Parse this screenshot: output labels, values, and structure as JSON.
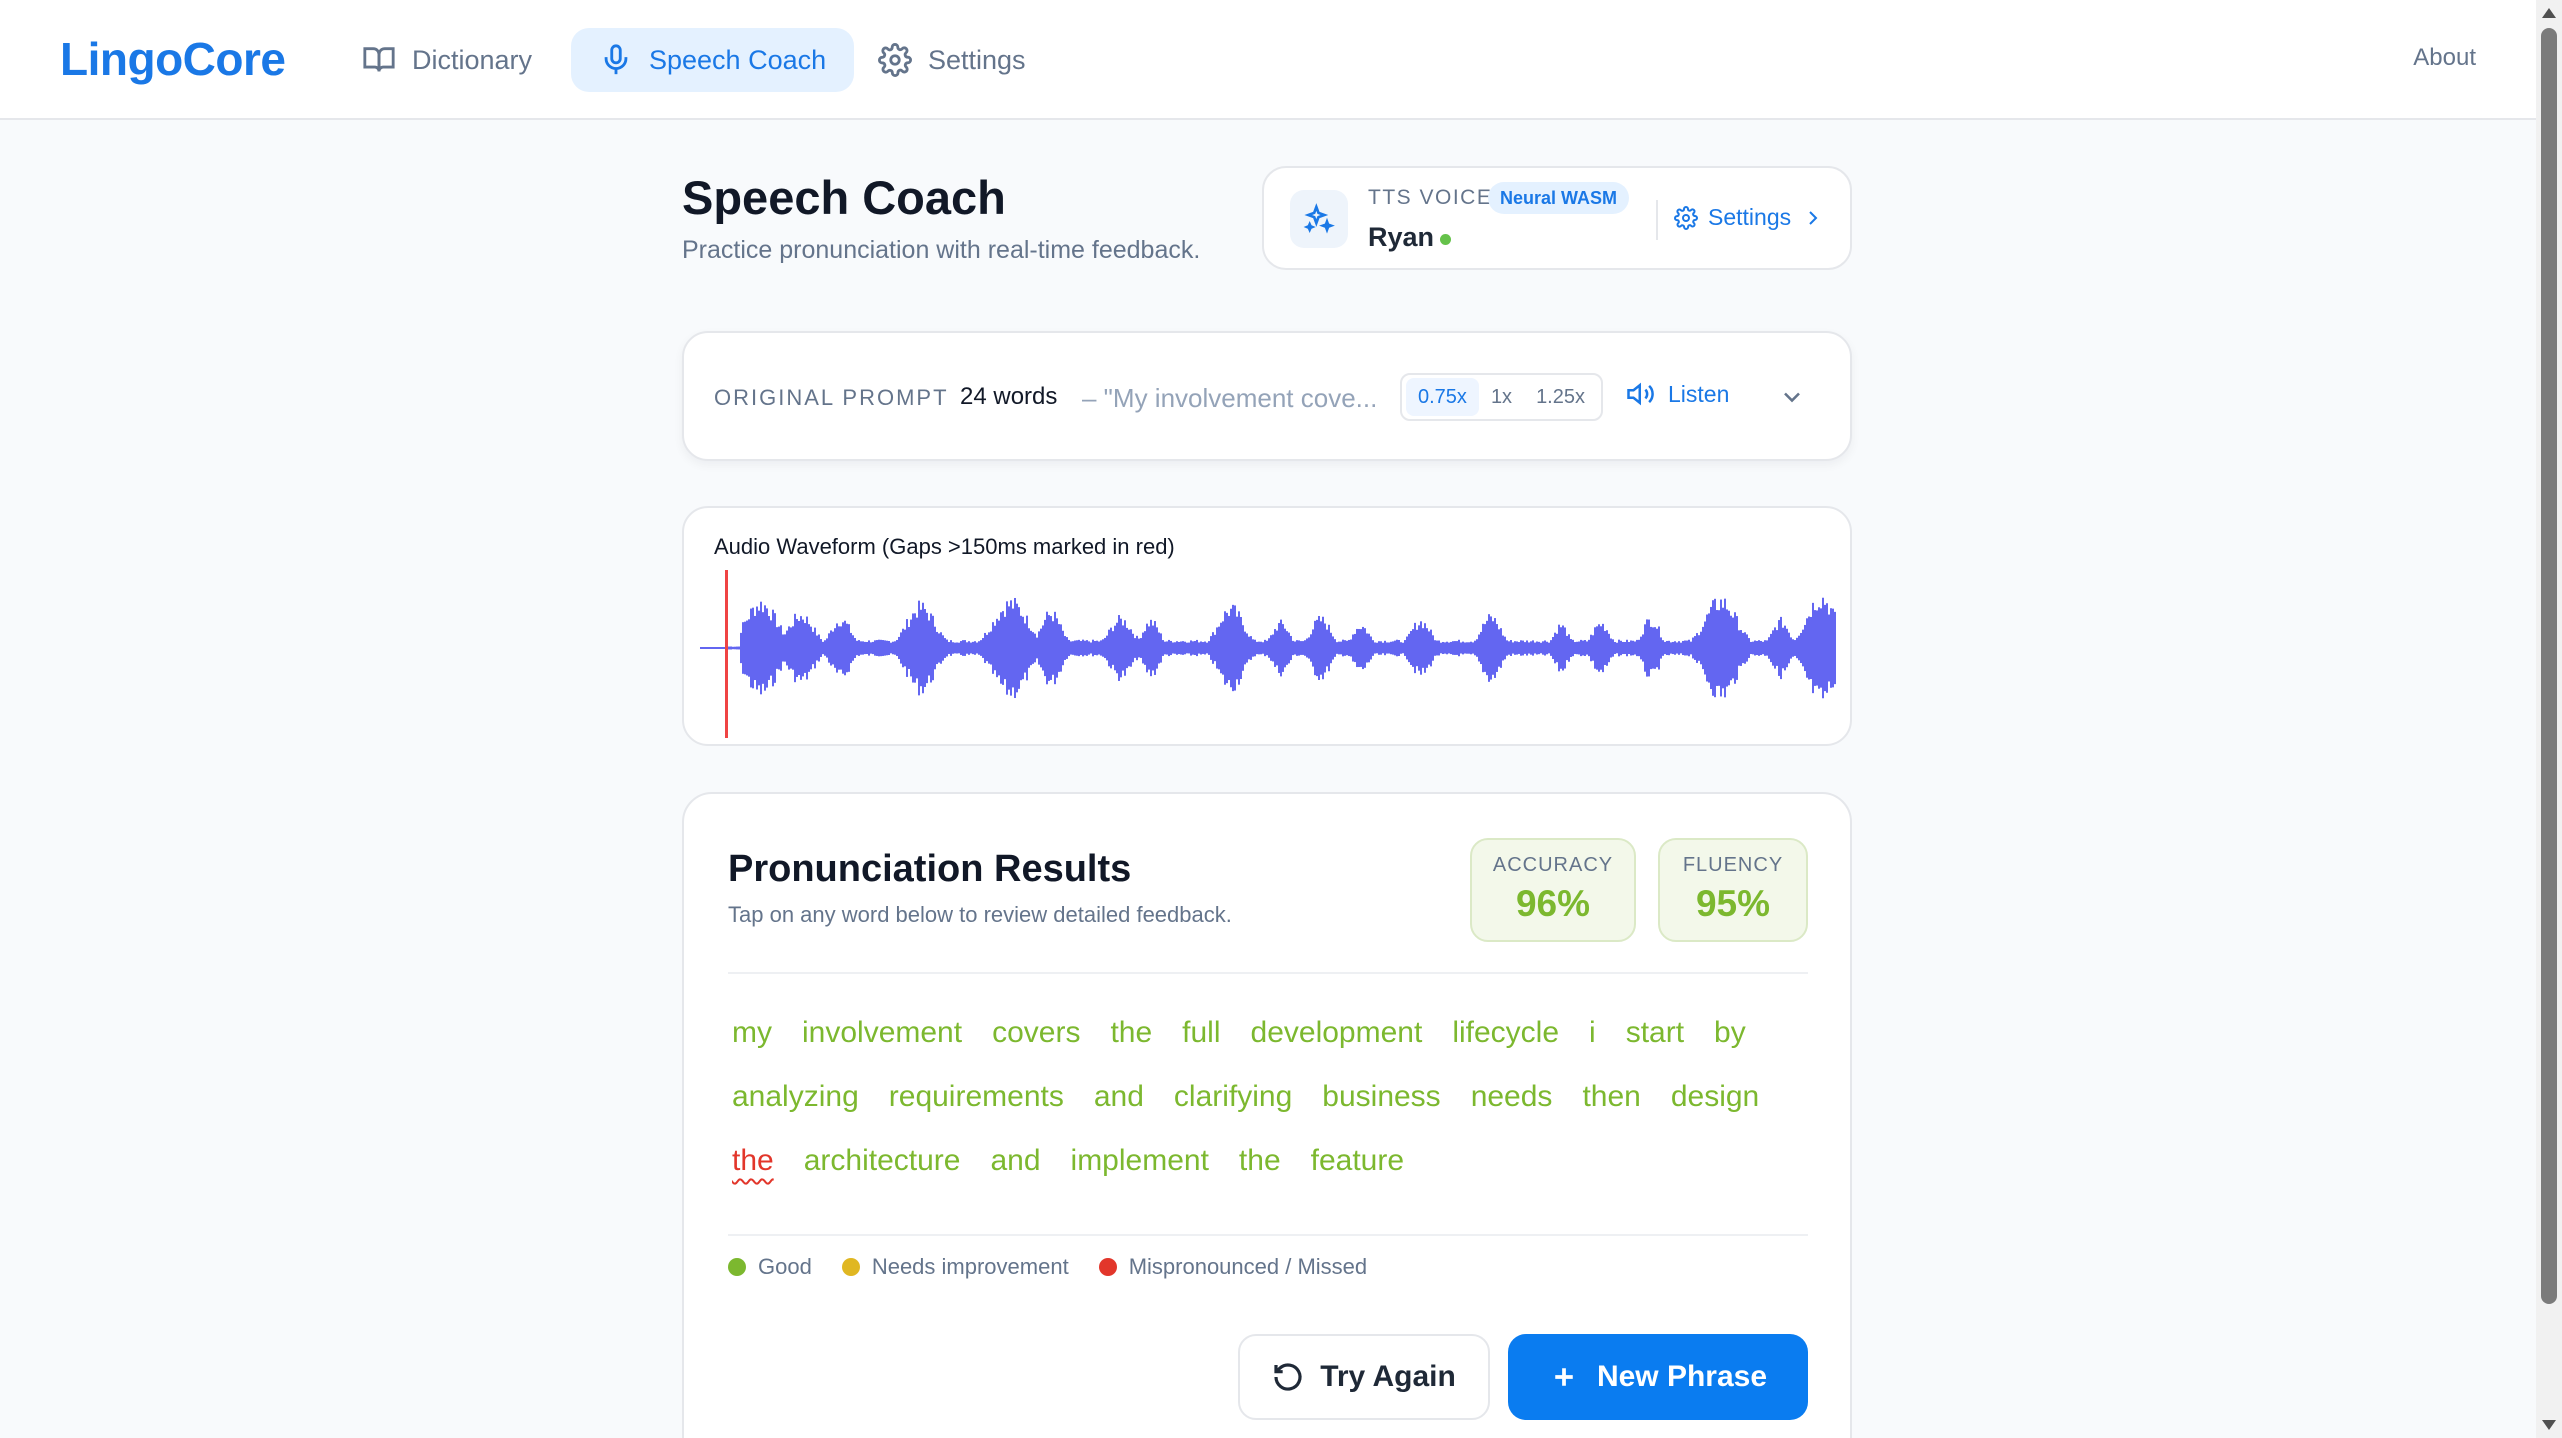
{
  "app": {
    "brand": "LingoCore",
    "nav": [
      {
        "label": "Dictionary",
        "icon": "book-icon",
        "active": false
      },
      {
        "label": "Speech Coach",
        "icon": "microphone-icon",
        "active": true
      },
      {
        "label": "Settings",
        "icon": "gear-icon",
        "active": false
      }
    ],
    "about": "About"
  },
  "header": {
    "title": "Speech Coach",
    "subtitle": "Practice pronunciation with real-time feedback."
  },
  "tts": {
    "label": "TTS VOICE",
    "badge": "Neural WASM",
    "voice": "Ryan",
    "status_color": "#65c24a",
    "settings_label": "Settings"
  },
  "prompt": {
    "label": "ORIGINAL PROMPT",
    "word_count": "24 words",
    "preview": "– \"My involvement cove...",
    "speeds": [
      "0.75x",
      "1x",
      "1.25x"
    ],
    "selected_speed": "0.75x",
    "listen_label": "Listen"
  },
  "waveform": {
    "title": "Audio Waveform (Gaps >150ms marked in red)",
    "wave_color": "#6366f1",
    "gap_marker_color": "#ef4444"
  },
  "results": {
    "title": "Pronunciation Results",
    "subtitle": "Tap on any word below to review detailed feedback.",
    "accuracy_label": "ACCURACY",
    "accuracy_value": "96%",
    "fluency_label": "FLUENCY",
    "fluency_value": "95%",
    "words": [
      {
        "text": "my",
        "status": "good"
      },
      {
        "text": "involvement",
        "status": "good"
      },
      {
        "text": "covers",
        "status": "good"
      },
      {
        "text": "the",
        "status": "good"
      },
      {
        "text": "full",
        "status": "good"
      },
      {
        "text": "development",
        "status": "good"
      },
      {
        "text": "lifecycle",
        "status": "good"
      },
      {
        "text": "i",
        "status": "good"
      },
      {
        "text": "start",
        "status": "good"
      },
      {
        "text": "by",
        "status": "good"
      },
      {
        "text": "analyzing",
        "status": "good"
      },
      {
        "text": "requirements",
        "status": "good"
      },
      {
        "text": "and",
        "status": "good"
      },
      {
        "text": "clarifying",
        "status": "good"
      },
      {
        "text": "business",
        "status": "good"
      },
      {
        "text": "needs",
        "status": "good"
      },
      {
        "text": "then",
        "status": "good"
      },
      {
        "text": "design",
        "status": "good"
      },
      {
        "text": "the",
        "status": "bad"
      },
      {
        "text": "architecture",
        "status": "good"
      },
      {
        "text": "and",
        "status": "good"
      },
      {
        "text": "implement",
        "status": "good"
      },
      {
        "text": "the",
        "status": "good"
      },
      {
        "text": "feature",
        "status": "good"
      }
    ],
    "legend": [
      {
        "label": "Good",
        "color": "#7cb82f"
      },
      {
        "label": "Needs improvement",
        "color": "#e0b722"
      },
      {
        "label": "Mispronounced / Missed",
        "color": "#e2362b"
      }
    ],
    "try_again_label": "Try Again",
    "new_phrase_label": "New Phrase"
  }
}
